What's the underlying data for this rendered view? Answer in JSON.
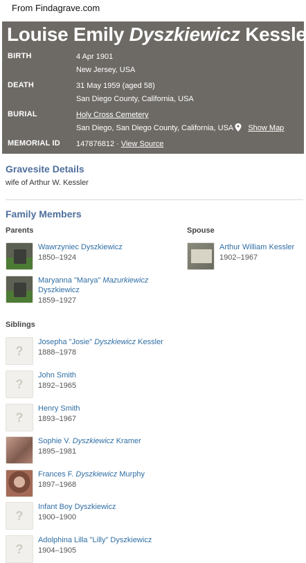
{
  "source_note": "From Findagrave.com",
  "memorial": {
    "name_first": "Louise Emily",
    "name_maiden": "Dyszkiewicz",
    "name_last": "Kessler",
    "birth_label": "BIRTH",
    "birth_date": "4 Apr 1901",
    "birth_place": "New Jersey, USA",
    "death_label": "DEATH",
    "death_date": "31 May 1959 (aged 58)",
    "death_place": "San Diego County, California, USA",
    "burial_label": "BURIAL",
    "burial_cemetery": "Holy Cross Cemetery",
    "burial_place": "San Diego, San Diego County, California, USA",
    "show_map": "Show Map",
    "memorial_id_label": "MEMORIAL ID",
    "memorial_id": "147876812 ·",
    "view_source": "View Source"
  },
  "gravesite": {
    "title": "Gravesite Details",
    "note": "wife of Arthur W. Kessler"
  },
  "family": {
    "title": "Family Members",
    "parents_label": "Parents",
    "spouse_label": "Spouse",
    "siblings_label": "Siblings",
    "parents": [
      {
        "pre": "Wawrzyniec Dyszkiewicz",
        "ital": "",
        "post": "",
        "line2": "",
        "dates": "1850–1924",
        "photo": "headstone"
      },
      {
        "pre": "Maryanna \"Marya\" ",
        "ital": "Mazurkiewicz",
        "post": "",
        "line2": "Dyszkiewicz",
        "dates": "1859–1927",
        "photo": "headstone"
      }
    ],
    "spouse": [
      {
        "pre": "Arthur William Kessler",
        "ital": "",
        "post": "",
        "line2": "",
        "dates": "1902–1967",
        "photo": "flat-marker"
      }
    ],
    "siblings": [
      {
        "pre": "Josepha \"Josie\" ",
        "ital": "Dyszkiewicz",
        "post": " Kessler",
        "dates": "1888–1978",
        "photo": "placeholder"
      },
      {
        "pre": "John Smith",
        "ital": "",
        "post": "",
        "dates": "1892–1965",
        "photo": "placeholder"
      },
      {
        "pre": "Henry Smith",
        "ital": "",
        "post": "",
        "dates": "1893–1967",
        "photo": "placeholder"
      },
      {
        "pre": "Sophie V. ",
        "ital": "Dyszkiewicz",
        "post": " Kramer",
        "dates": "1895–1981",
        "photo": "marble"
      },
      {
        "pre": "Frances F. ",
        "ital": "Dyszkiewicz",
        "post": " Murphy",
        "dates": "1897–1968",
        "photo": "portrait"
      },
      {
        "pre": "Infant Boy Dyszkiewicz",
        "ital": "",
        "post": "",
        "dates": "1900–1900",
        "photo": "placeholder"
      },
      {
        "pre": "Adolphina Lilla \"Lilly\" Dyszkiewicz",
        "ital": "",
        "post": "",
        "dates": "1904–1905",
        "photo": "placeholder"
      }
    ]
  }
}
